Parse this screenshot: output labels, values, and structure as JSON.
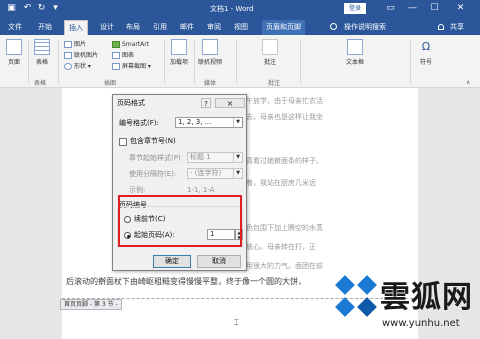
{
  "titlebar": {
    "doc_title": "文档1 - Word",
    "login": "登录",
    "window_controls": [
      "▭",
      "—",
      "☐",
      "✕"
    ]
  },
  "tabs": [
    {
      "label": "文件"
    },
    {
      "label": "开始"
    },
    {
      "label": "插入",
      "active": true
    },
    {
      "label": "设计"
    },
    {
      "label": "布局"
    },
    {
      "label": "引用"
    },
    {
      "label": "邮件"
    },
    {
      "label": "审阅"
    },
    {
      "label": "视图"
    },
    {
      "label": "页眉和页脚",
      "contextual": true
    },
    {
      "label": "操作说明搜索"
    },
    {
      "label": "共享"
    }
  ],
  "ribbon": {
    "pages": "页面",
    "table": "表格",
    "pictures": "图片",
    "online_pictures": "联机图片",
    "shapes": "形状",
    "smartart": "SmartArt",
    "chart": "图表",
    "screenshot": "屏幕截图",
    "addins": "加载项",
    "online_video": "联机视频",
    "comment": "批注",
    "textbox": "文本框",
    "symbol": "符号",
    "groups": {
      "tables": "表格",
      "illustrations": "插图",
      "media": "媒体",
      "comments": "批注"
    }
  },
  "document": {
    "lines": [
      "上午放学，由于母亲忙农活",
      "去去。母亲也是这样让我坐",
      "认真看过她擀面条的样子。",
      "开着，我站在厨房几米远",
      "衣色包围下加上腾空的水蒸",
      "不放心。母亲转在打，正",
      "要用很大的力气。面团在前",
      "后滚动的擀面杖下由崎岖粗糙变得慢慢平整，终于像一个圆的大饼，"
    ],
    "footer_tag": "首页页脚 - 第 3 节 -"
  },
  "dialog": {
    "title": "页码格式",
    "help": "?",
    "close": "×",
    "number_format_label": "编号格式(F):",
    "number_format_value": "1, 2, 3, ...",
    "include_chapter": "包含章节号(N)",
    "chapter_style_label": "章节起始样式(P)",
    "chapter_style_value": "标题 1",
    "separator_label": "使用分隔符(E):",
    "separator_value": "-  (连字符)",
    "example_label": "示例:",
    "example_value": "1-1, 1-A",
    "page_numbering": "页码编号",
    "continue_prev": "续前节(C)",
    "start_at": "起始页码(A):",
    "start_at_value": "1",
    "ok": "确定",
    "cancel": "取消"
  },
  "watermark": {
    "text": "雲狐网",
    "url": "www.yunhu.net"
  },
  "colors": {
    "accent": "#2b579a",
    "highlight": "#e02020",
    "watermark_blue": "#1a7ad4"
  }
}
